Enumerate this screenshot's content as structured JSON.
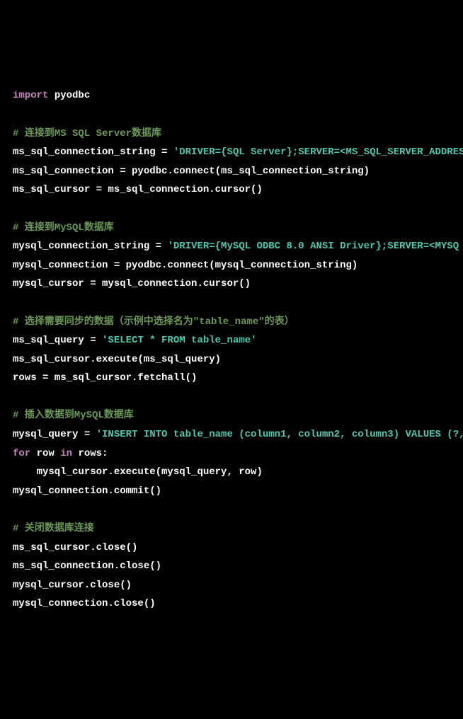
{
  "code": {
    "lines": [
      {
        "type": "import",
        "parts": [
          {
            "text": "import",
            "class": "keyword"
          },
          {
            "text": " pyodbc",
            "class": "default"
          }
        ]
      },
      {
        "type": "empty"
      },
      {
        "type": "comment",
        "parts": [
          {
            "text": "# 连接到MS SQL Server数据库",
            "class": "comment"
          }
        ]
      },
      {
        "type": "code",
        "parts": [
          {
            "text": "ms_sql_connection_string = ",
            "class": "default"
          },
          {
            "text": "'DRIVER={SQL Server};SERVER=<MS_SQL_SERVER_ADDRES",
            "class": "string"
          }
        ]
      },
      {
        "type": "code",
        "parts": [
          {
            "text": "ms_sql_connection = pyodbc.connect(ms_sql_connection_string)",
            "class": "default"
          }
        ]
      },
      {
        "type": "code",
        "parts": [
          {
            "text": "ms_sql_cursor = ms_sql_connection.cursor()",
            "class": "default"
          }
        ]
      },
      {
        "type": "empty"
      },
      {
        "type": "comment",
        "parts": [
          {
            "text": "# 连接到MySQL数据库",
            "class": "comment"
          }
        ]
      },
      {
        "type": "code",
        "parts": [
          {
            "text": "mysql_connection_string = ",
            "class": "default"
          },
          {
            "text": "'DRIVER={MySQL ODBC 8.0 ANSI Driver};SERVER=<MYSQ",
            "class": "string"
          }
        ]
      },
      {
        "type": "code",
        "parts": [
          {
            "text": "mysql_connection = pyodbc.connect(mysql_connection_string)",
            "class": "default"
          }
        ]
      },
      {
        "type": "code",
        "parts": [
          {
            "text": "mysql_cursor = mysql_connection.cursor()",
            "class": "default"
          }
        ]
      },
      {
        "type": "empty"
      },
      {
        "type": "comment",
        "parts": [
          {
            "text": "# 选择需要同步的数据（示例中选择名为\"table_name\"的表）",
            "class": "comment"
          }
        ]
      },
      {
        "type": "code",
        "parts": [
          {
            "text": "ms_sql_query = ",
            "class": "default"
          },
          {
            "text": "'SELECT * FROM table_name'",
            "class": "string"
          }
        ]
      },
      {
        "type": "code",
        "parts": [
          {
            "text": "ms_sql_cursor.execute(ms_sql_query)",
            "class": "default"
          }
        ]
      },
      {
        "type": "code",
        "parts": [
          {
            "text": "rows = ms_sql_cursor.fetchall()",
            "class": "default"
          }
        ]
      },
      {
        "type": "empty"
      },
      {
        "type": "comment",
        "parts": [
          {
            "text": "# 插入数据到MySQL数据库",
            "class": "comment"
          }
        ]
      },
      {
        "type": "code",
        "parts": [
          {
            "text": "mysql_query = ",
            "class": "default"
          },
          {
            "text": "'INSERT INTO table_name (column1, column2, column3) VALUES (?,",
            "class": "string"
          }
        ]
      },
      {
        "type": "code",
        "parts": [
          {
            "text": "for",
            "class": "keyword"
          },
          {
            "text": " row ",
            "class": "default"
          },
          {
            "text": "in",
            "class": "keyword"
          },
          {
            "text": " rows:",
            "class": "default"
          }
        ]
      },
      {
        "type": "code",
        "parts": [
          {
            "text": "    mysql_cursor.execute(mysql_query, row)",
            "class": "default"
          }
        ]
      },
      {
        "type": "code",
        "parts": [
          {
            "text": "mysql_connection.commit()",
            "class": "default"
          }
        ]
      },
      {
        "type": "empty"
      },
      {
        "type": "comment",
        "parts": [
          {
            "text": "# 关闭数据库连接",
            "class": "comment"
          }
        ]
      },
      {
        "type": "code",
        "parts": [
          {
            "text": "ms_sql_cursor.close()",
            "class": "default"
          }
        ]
      },
      {
        "type": "code",
        "parts": [
          {
            "text": "ms_sql_connection.close()",
            "class": "default"
          }
        ]
      },
      {
        "type": "code",
        "parts": [
          {
            "text": "mysql_cursor.close()",
            "class": "default"
          }
        ]
      },
      {
        "type": "code",
        "parts": [
          {
            "text": "mysql_connection.close()",
            "class": "default"
          }
        ]
      }
    ]
  }
}
